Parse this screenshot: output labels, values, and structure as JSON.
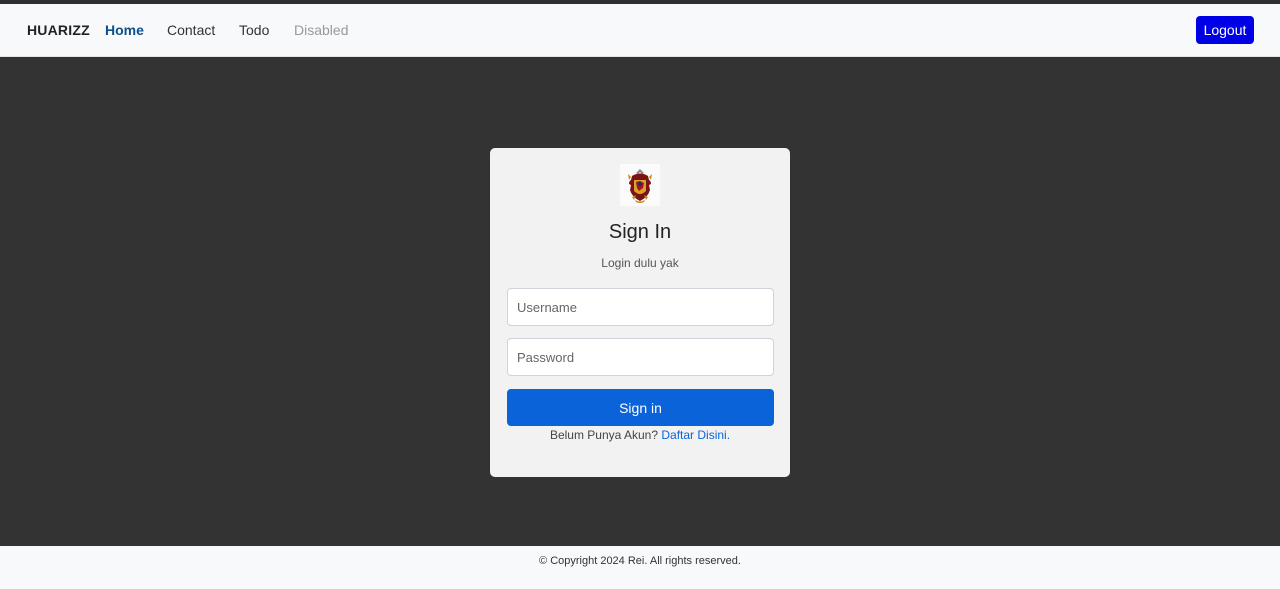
{
  "navbar": {
    "brand": "HUARIZZ",
    "links": [
      {
        "label": "Home",
        "state": "active"
      },
      {
        "label": "Contact",
        "state": "normal"
      },
      {
        "label": "Todo",
        "state": "normal"
      },
      {
        "label": "Disabled",
        "state": "disabled"
      }
    ],
    "logout_label": "Logout",
    "logout_color": "#0000e6"
  },
  "login_card": {
    "logo_icon": "crest-icon",
    "title": "Sign In",
    "subtitle": "Login dulu yak",
    "username_placeholder": "Username",
    "password_placeholder": "Password",
    "signin_label": "Sign in",
    "signin_color": "#0a63d8",
    "register_prompt": "Belum Punya Akun?",
    "register_link": "Daftar Disini."
  },
  "footer": {
    "text": "© Copyright 2024 Rei. All rights reserved."
  }
}
